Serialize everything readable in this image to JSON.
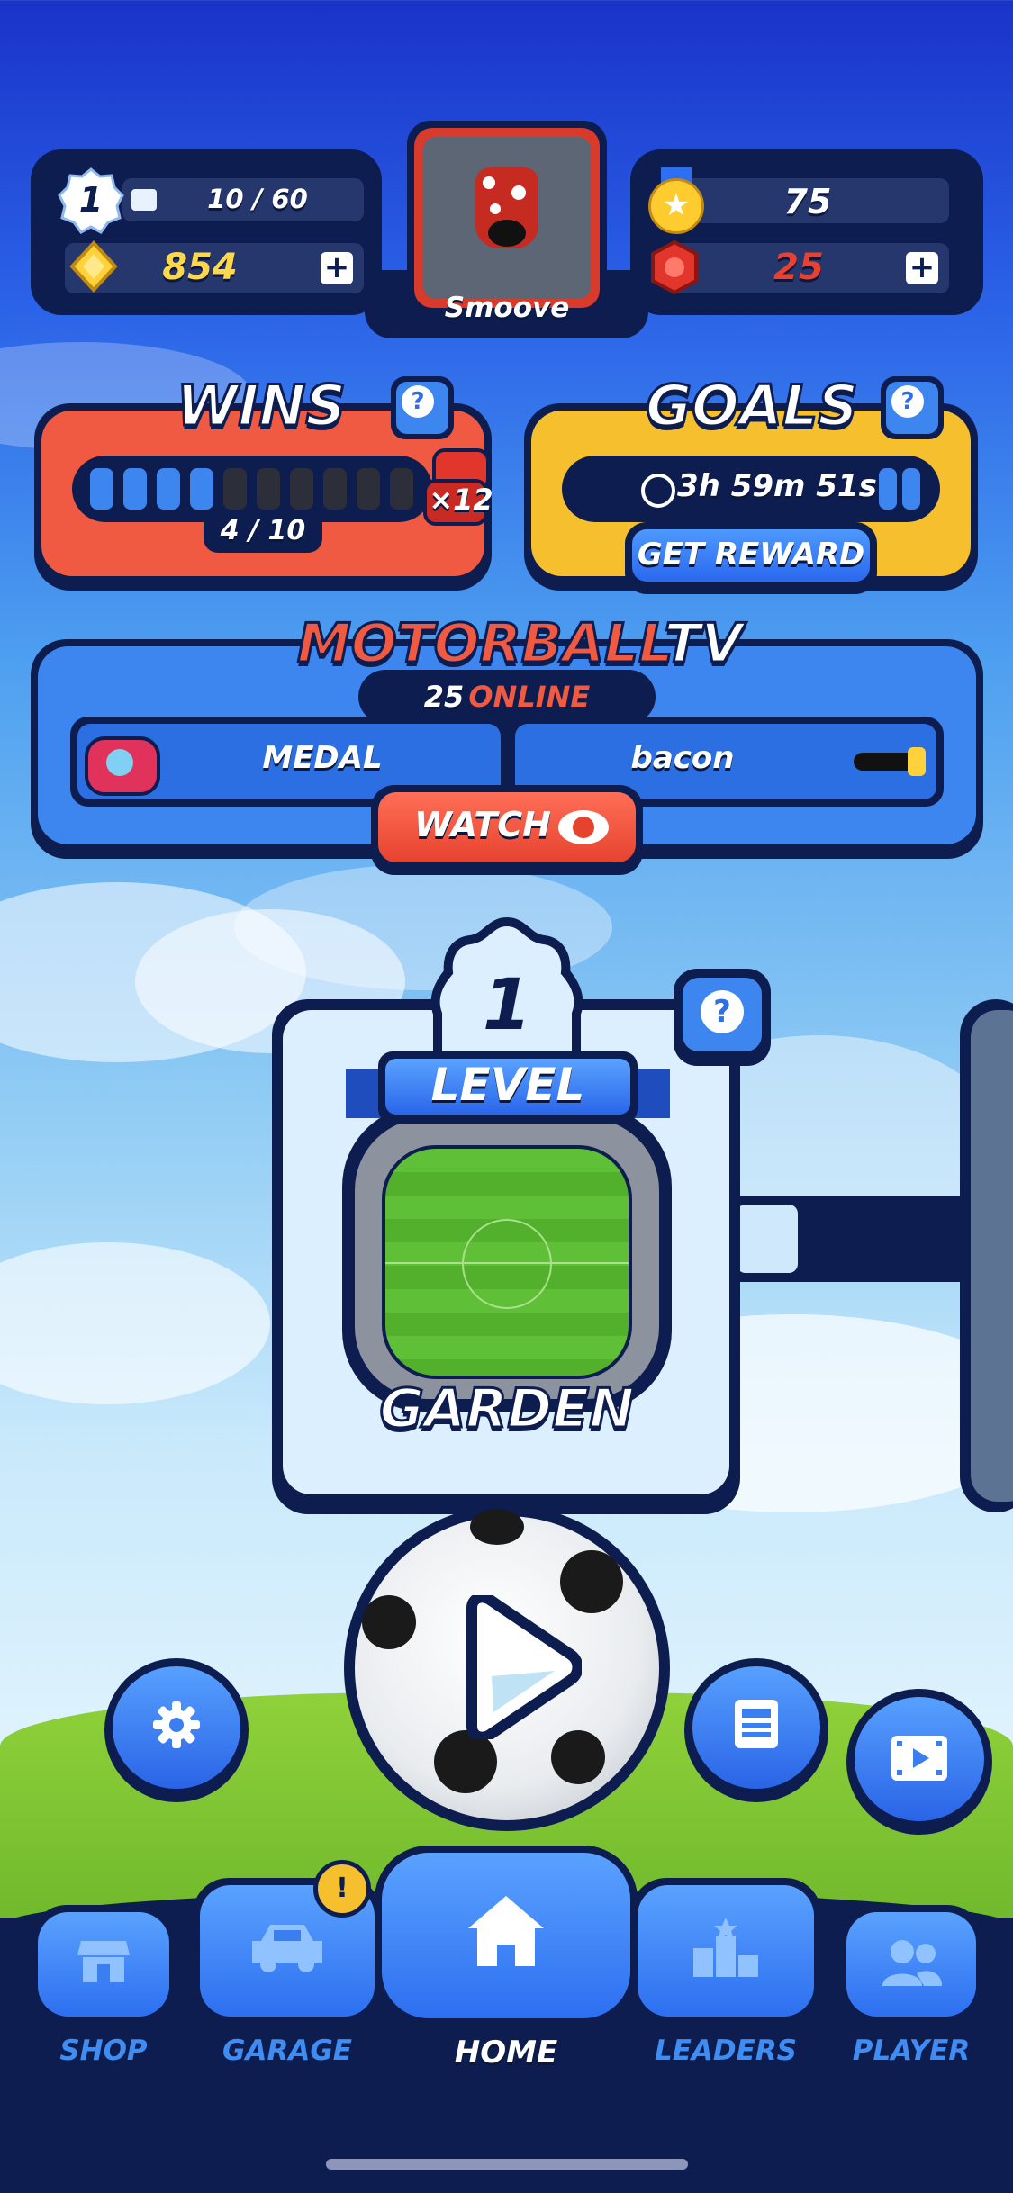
{
  "player": {
    "level": "1",
    "xp": "10 / 60",
    "name": "Smoove",
    "gems": "854",
    "trophies": "75",
    "rubies": "25"
  },
  "wins": {
    "title": "WINS",
    "progress": "4 / 10",
    "progress_fraction": 0.4,
    "reward": "×12",
    "help": "?"
  },
  "goals": {
    "title": "GOALS",
    "timer": "3h 59m 51s",
    "reward_button": "GET REWARD",
    "help": "?"
  },
  "tv": {
    "title_red": "MOTORBALL",
    "title_white": "TV",
    "online_count": "25",
    "online_label": "ONLINE",
    "left_player": "MEDAL",
    "right_player": "bacon",
    "watch_button": "WATCH"
  },
  "level": {
    "number": "1",
    "label": "LEVEL",
    "name": "GARDEN",
    "help": "?"
  },
  "nav": {
    "shop": "SHOP",
    "garage": "GARAGE",
    "home": "HOME",
    "leaders": "LEADERS",
    "player": "PLAYER",
    "garage_badge": "!"
  },
  "colors": {
    "accent_blue": "#3f8cf3",
    "dark_navy": "#0d1d4f",
    "wins_red": "#f05a42",
    "goals_yellow": "#f6bf2e",
    "ruby": "#e9402f",
    "gem_yellow": "#ffd84a"
  },
  "icons": [
    "settings-gear-icon",
    "news-icon",
    "video-icon",
    "play-icon",
    "shop-icon",
    "car-icon",
    "home-icon",
    "podium-icon",
    "players-icon",
    "stopwatch-icon",
    "eye-icon"
  ]
}
